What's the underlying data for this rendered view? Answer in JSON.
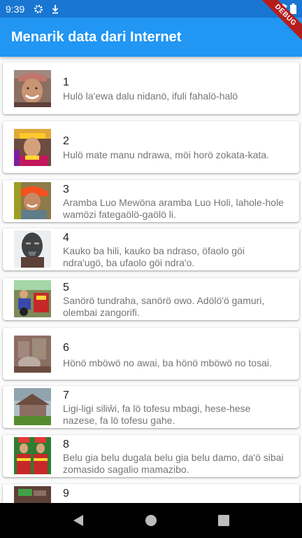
{
  "status_bar": {
    "time": "9:39",
    "icons": [
      "gear-icon",
      "download-icon",
      "wifi-icon",
      "battery-icon"
    ]
  },
  "app_bar": {
    "title": "Menarik data dari Internet"
  },
  "debug_banner": {
    "label": "DEBUG"
  },
  "items": [
    {
      "number": "1",
      "text": "Hulö la'ewa dalu nidanö, ifuli fahalö-halö"
    },
    {
      "number": "2",
      "text": "Hulö mate manu ndrawa, möi horö zokata-kata."
    },
    {
      "number": "3",
      "text": "Aramba Luo Mewöna aramba Luo Holi, lahole-hole wamözi fategaölö-gaölö li."
    },
    {
      "number": "4",
      "text": "Kauko ba hili, kauko ba ndraso, öfaolo göi ndra'ugö, ba ufaolo göi ndra'o."
    },
    {
      "number": "5",
      "text": "Sanörö tundraha, sanörö owo. Adölö'ö gamuri, olembai zangorifi."
    },
    {
      "number": "6",
      "text": "Hönö mböwö no awai, ba hönö mböwö no tosai."
    },
    {
      "number": "7",
      "text": "Ligi-ligi siliŵi, fa lö tofesu mbagi, hese-hese nazese, fa lö tofesu gahe."
    },
    {
      "number": "8",
      "text": "Belu gia belu dugala belu gia belu damo, da'ö sibai zomasido sagalio mamazibo."
    },
    {
      "number": "9",
      "text": ""
    }
  ],
  "colors": {
    "app_bar": "#2196f3",
    "status_bar": "#1976d2",
    "debug_banner": "#b71c1c"
  },
  "nav": [
    "back-icon",
    "home-icon",
    "recents-icon"
  ]
}
